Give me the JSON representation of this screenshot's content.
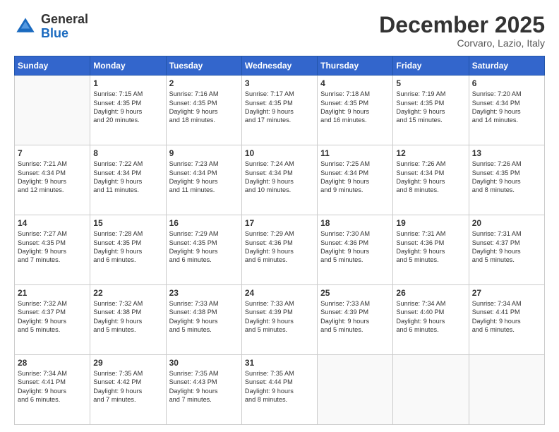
{
  "logo": {
    "general": "General",
    "blue": "Blue"
  },
  "header": {
    "month": "December 2025",
    "location": "Corvaro, Lazio, Italy"
  },
  "weekdays": [
    "Sunday",
    "Monday",
    "Tuesday",
    "Wednesday",
    "Thursday",
    "Friday",
    "Saturday"
  ],
  "weeks": [
    [
      {
        "day": "",
        "info": ""
      },
      {
        "day": "1",
        "info": "Sunrise: 7:15 AM\nSunset: 4:35 PM\nDaylight: 9 hours\nand 20 minutes."
      },
      {
        "day": "2",
        "info": "Sunrise: 7:16 AM\nSunset: 4:35 PM\nDaylight: 9 hours\nand 18 minutes."
      },
      {
        "day": "3",
        "info": "Sunrise: 7:17 AM\nSunset: 4:35 PM\nDaylight: 9 hours\nand 17 minutes."
      },
      {
        "day": "4",
        "info": "Sunrise: 7:18 AM\nSunset: 4:35 PM\nDaylight: 9 hours\nand 16 minutes."
      },
      {
        "day": "5",
        "info": "Sunrise: 7:19 AM\nSunset: 4:35 PM\nDaylight: 9 hours\nand 15 minutes."
      },
      {
        "day": "6",
        "info": "Sunrise: 7:20 AM\nSunset: 4:34 PM\nDaylight: 9 hours\nand 14 minutes."
      }
    ],
    [
      {
        "day": "7",
        "info": "Sunrise: 7:21 AM\nSunset: 4:34 PM\nDaylight: 9 hours\nand 12 minutes."
      },
      {
        "day": "8",
        "info": "Sunrise: 7:22 AM\nSunset: 4:34 PM\nDaylight: 9 hours\nand 11 minutes."
      },
      {
        "day": "9",
        "info": "Sunrise: 7:23 AM\nSunset: 4:34 PM\nDaylight: 9 hours\nand 11 minutes."
      },
      {
        "day": "10",
        "info": "Sunrise: 7:24 AM\nSunset: 4:34 PM\nDaylight: 9 hours\nand 10 minutes."
      },
      {
        "day": "11",
        "info": "Sunrise: 7:25 AM\nSunset: 4:34 PM\nDaylight: 9 hours\nand 9 minutes."
      },
      {
        "day": "12",
        "info": "Sunrise: 7:26 AM\nSunset: 4:34 PM\nDaylight: 9 hours\nand 8 minutes."
      },
      {
        "day": "13",
        "info": "Sunrise: 7:26 AM\nSunset: 4:35 PM\nDaylight: 9 hours\nand 8 minutes."
      }
    ],
    [
      {
        "day": "14",
        "info": "Sunrise: 7:27 AM\nSunset: 4:35 PM\nDaylight: 9 hours\nand 7 minutes."
      },
      {
        "day": "15",
        "info": "Sunrise: 7:28 AM\nSunset: 4:35 PM\nDaylight: 9 hours\nand 6 minutes."
      },
      {
        "day": "16",
        "info": "Sunrise: 7:29 AM\nSunset: 4:35 PM\nDaylight: 9 hours\nand 6 minutes."
      },
      {
        "day": "17",
        "info": "Sunrise: 7:29 AM\nSunset: 4:36 PM\nDaylight: 9 hours\nand 6 minutes."
      },
      {
        "day": "18",
        "info": "Sunrise: 7:30 AM\nSunset: 4:36 PM\nDaylight: 9 hours\nand 5 minutes."
      },
      {
        "day": "19",
        "info": "Sunrise: 7:31 AM\nSunset: 4:36 PM\nDaylight: 9 hours\nand 5 minutes."
      },
      {
        "day": "20",
        "info": "Sunrise: 7:31 AM\nSunset: 4:37 PM\nDaylight: 9 hours\nand 5 minutes."
      }
    ],
    [
      {
        "day": "21",
        "info": "Sunrise: 7:32 AM\nSunset: 4:37 PM\nDaylight: 9 hours\nand 5 minutes."
      },
      {
        "day": "22",
        "info": "Sunrise: 7:32 AM\nSunset: 4:38 PM\nDaylight: 9 hours\nand 5 minutes."
      },
      {
        "day": "23",
        "info": "Sunrise: 7:33 AM\nSunset: 4:38 PM\nDaylight: 9 hours\nand 5 minutes."
      },
      {
        "day": "24",
        "info": "Sunrise: 7:33 AM\nSunset: 4:39 PM\nDaylight: 9 hours\nand 5 minutes."
      },
      {
        "day": "25",
        "info": "Sunrise: 7:33 AM\nSunset: 4:39 PM\nDaylight: 9 hours\nand 5 minutes."
      },
      {
        "day": "26",
        "info": "Sunrise: 7:34 AM\nSunset: 4:40 PM\nDaylight: 9 hours\nand 6 minutes."
      },
      {
        "day": "27",
        "info": "Sunrise: 7:34 AM\nSunset: 4:41 PM\nDaylight: 9 hours\nand 6 minutes."
      }
    ],
    [
      {
        "day": "28",
        "info": "Sunrise: 7:34 AM\nSunset: 4:41 PM\nDaylight: 9 hours\nand 6 minutes."
      },
      {
        "day": "29",
        "info": "Sunrise: 7:35 AM\nSunset: 4:42 PM\nDaylight: 9 hours\nand 7 minutes."
      },
      {
        "day": "30",
        "info": "Sunrise: 7:35 AM\nSunset: 4:43 PM\nDaylight: 9 hours\nand 7 minutes."
      },
      {
        "day": "31",
        "info": "Sunrise: 7:35 AM\nSunset: 4:44 PM\nDaylight: 9 hours\nand 8 minutes."
      },
      {
        "day": "",
        "info": ""
      },
      {
        "day": "",
        "info": ""
      },
      {
        "day": "",
        "info": ""
      }
    ]
  ]
}
